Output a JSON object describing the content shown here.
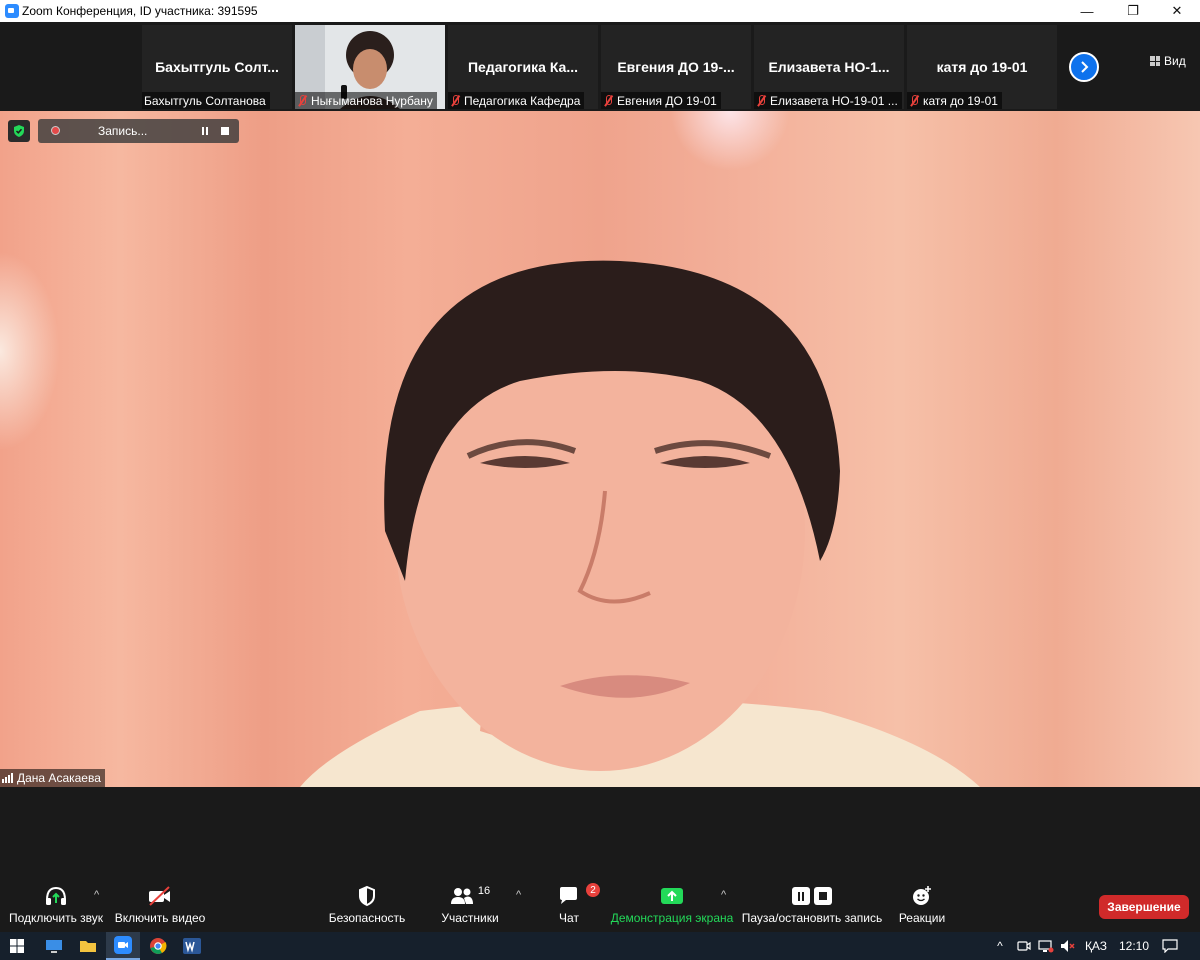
{
  "window": {
    "title": "Zoom Конференция, ID участника: 391595",
    "minimize_glyph": "—",
    "maximize_glyph": "❐",
    "close_glyph": "✕"
  },
  "gallery": {
    "tiles": [
      {
        "big_name": "Бахытгуль  Солт...",
        "caption": "Бахытгуль Солтанова",
        "muted": false
      },
      {
        "big_name": "",
        "caption": "Нығыманова Нурбану",
        "muted": true
      },
      {
        "big_name": "Педагогика  Ка...",
        "caption": "Педагогика Кафедра",
        "muted": true
      },
      {
        "big_name": "Евгения  ДО  19-...",
        "caption": "Евгения ДО 19-01",
        "muted": true
      },
      {
        "big_name": "Елизавета  НО-1...",
        "caption": "Елизавета НО-19-01 ...",
        "muted": true
      },
      {
        "big_name": "катя до 19-01",
        "caption": "катя до 19-01",
        "muted": true
      }
    ],
    "next_icon": "chevron-right-icon",
    "view_label": "Вид"
  },
  "recording": {
    "label": "Запись..."
  },
  "main_video": {
    "speaker_name": "Дана Асакаева"
  },
  "toolbar": {
    "audio_label": "Подключить звук",
    "video_label": "Включить видео",
    "security_label": "Безопасность",
    "participants_label": "Участники",
    "participants_count": "16",
    "chat_label": "Чат",
    "chat_badge": "2",
    "share_label": "Демонстрация экрана",
    "record_label": "Пауза/остановить запись",
    "reactions_label": "Реакции",
    "end_label": "Завершение",
    "caret_glyph": "^"
  },
  "taskbar": {
    "language": "ҚАЗ",
    "time": "12:10",
    "tray_caret": "^"
  },
  "colors": {
    "accent_blue": "#0e72ed",
    "share_green": "#23d959",
    "end_red": "#d02a2a",
    "muted_red": "#e8413c"
  }
}
